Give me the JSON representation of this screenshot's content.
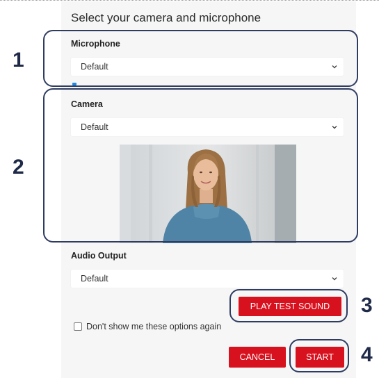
{
  "dialog": {
    "title": "Select your camera and microphone",
    "microphone": {
      "label": "Microphone",
      "value": "Default"
    },
    "camera": {
      "label": "Camera",
      "value": "Default"
    },
    "audio_output": {
      "label": "Audio Output",
      "value": "Default"
    },
    "play_test_sound_label": "PLAY TEST SOUND",
    "dont_show_label": "Don't show me these options again",
    "dont_show_checked": false,
    "cancel_label": "CANCEL",
    "start_label": "START"
  },
  "callouts": [
    "1",
    "2",
    "3",
    "4"
  ],
  "colors": {
    "accent_red": "#d7111d",
    "callout_navy": "#2f3c61",
    "level_blue": "#1e88e5"
  },
  "icons": [
    "chevron-down-icon"
  ]
}
